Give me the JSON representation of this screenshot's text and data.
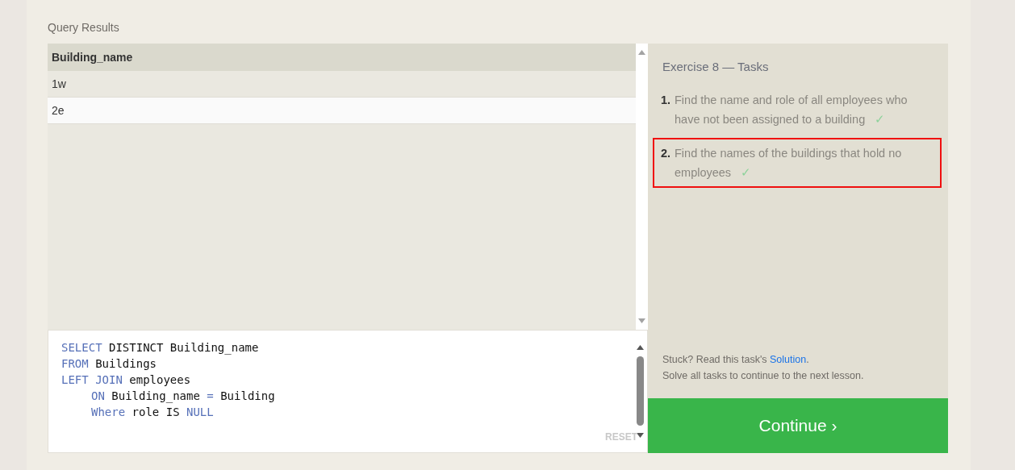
{
  "results": {
    "title": "Query Results",
    "columns": [
      "Building_name"
    ],
    "rows": [
      [
        "1w"
      ],
      [
        "2e"
      ]
    ]
  },
  "editor": {
    "lines": [
      {
        "indented": false,
        "tokens": [
          {
            "kind": "keyword",
            "text": "SELECT"
          },
          {
            "kind": "plain",
            "text": " DISTINCT Building_name"
          }
        ]
      },
      {
        "indented": false,
        "tokens": [
          {
            "kind": "keyword",
            "text": "FROM"
          },
          {
            "kind": "plain",
            "text": " Buildings"
          }
        ]
      },
      {
        "indented": false,
        "tokens": [
          {
            "kind": "keyword",
            "text": "LEFT JOIN"
          },
          {
            "kind": "plain",
            "text": " employees"
          }
        ]
      },
      {
        "indented": true,
        "tokens": [
          {
            "kind": "keyword",
            "text": "ON"
          },
          {
            "kind": "plain",
            "text": " Building_name "
          },
          {
            "kind": "keyword",
            "text": "="
          },
          {
            "kind": "plain",
            "text": " Building"
          }
        ]
      },
      {
        "indented": true,
        "tokens": [
          {
            "kind": "keyword",
            "text": "Where"
          },
          {
            "kind": "plain",
            "text": " role IS "
          },
          {
            "kind": "keyword",
            "text": "NULL"
          }
        ]
      }
    ],
    "reset": "RESET"
  },
  "tasks": {
    "title": "Exercise 8 — Tasks",
    "items": [
      {
        "number": "1.",
        "text": "Find the name and role of all employees who have not been assigned to a building",
        "mark": "✓",
        "highlighted": false
      },
      {
        "number": "2.",
        "text": "Find the names of the buildings that hold no employees",
        "mark": "✓",
        "highlighted": true
      }
    ],
    "hint": {
      "prefix": "Stuck? Read this task's ",
      "link": "Solution",
      "suffix": "."
    },
    "note": "Solve all tasks to continue to the next lesson.",
    "continue": "Continue ›"
  }
}
